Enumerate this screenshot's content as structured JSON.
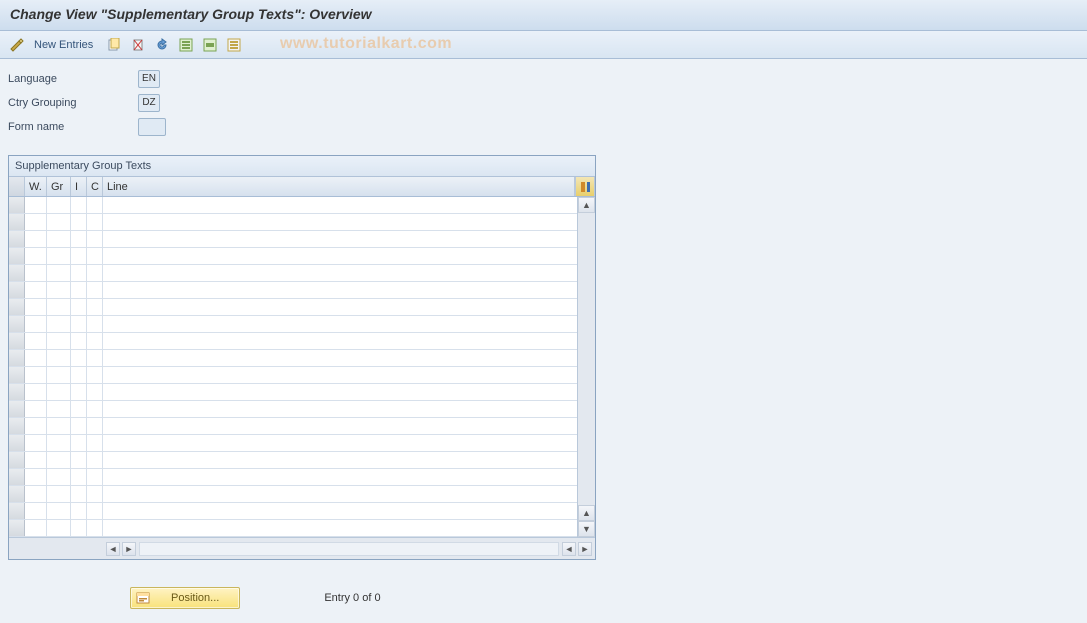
{
  "title": "Change View \"Supplementary Group Texts\": Overview",
  "toolbar": {
    "new_entries": "New Entries"
  },
  "watermark": "www.tutorialkart.com",
  "form": {
    "language_label": "Language",
    "language_value": "EN",
    "ctry_label": "Ctry Grouping",
    "ctry_value": "DZ",
    "formname_label": "Form name",
    "formname_value": ""
  },
  "table": {
    "title": "Supplementary Group Texts",
    "cols": {
      "w": "W.",
      "gr": "Gr",
      "i": "I",
      "c": "C",
      "line": "Line"
    },
    "row_count": 20
  },
  "footer": {
    "position_label": "Position...",
    "entry_status": "Entry 0 of 0"
  }
}
